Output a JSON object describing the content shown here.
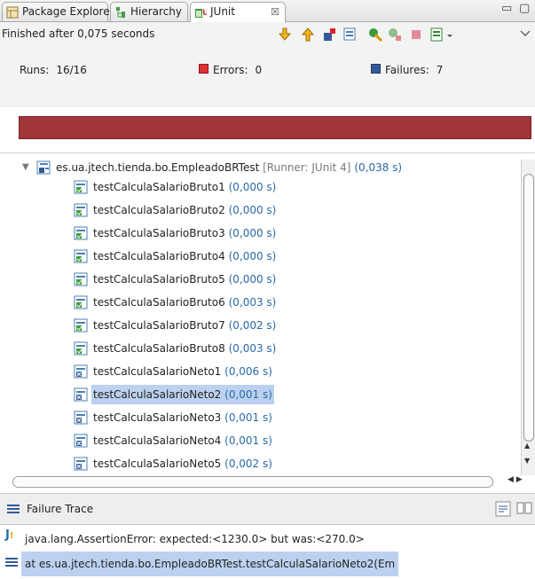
{
  "tabs": [
    {
      "label": "Package Explorer",
      "icon": "package-explorer-icon"
    },
    {
      "label": "Hierarchy",
      "icon": "hierarchy-icon"
    },
    {
      "label": "JUnit",
      "icon": "junit-icon",
      "close": "☒",
      "active": true
    }
  ],
  "view_controls": {
    "minimize": "▭",
    "maximize": "▢"
  },
  "status": {
    "text": "Finished after 0,075 seconds"
  },
  "counters": {
    "runs_label": "Runs:",
    "runs_value": "16/16",
    "errors_label": "Errors:",
    "errors_value": "0",
    "failures_label": "Failures:",
    "failures_value": "7"
  },
  "colors": {
    "progress": "#a0363a",
    "selection": "#bcd1ef",
    "time": "#2a6aa8"
  },
  "tree": {
    "root": {
      "label": "es.ua.jtech.tienda.bo.EmpleadoBRTest",
      "runner": "[Runner: JUnit 4]",
      "time": "(0,038 s)"
    },
    "items": [
      {
        "label": "testCalculaSalarioBruto1",
        "time": "(0,000 s)",
        "status": "pass"
      },
      {
        "label": "testCalculaSalarioBruto2",
        "time": "(0,000 s)",
        "status": "pass"
      },
      {
        "label": "testCalculaSalarioBruto3",
        "time": "(0,000 s)",
        "status": "pass"
      },
      {
        "label": "testCalculaSalarioBruto4",
        "time": "(0,000 s)",
        "status": "pass"
      },
      {
        "label": "testCalculaSalarioBruto5",
        "time": "(0,000 s)",
        "status": "pass"
      },
      {
        "label": "testCalculaSalarioBruto6",
        "time": "(0,003 s)",
        "status": "pass"
      },
      {
        "label": "testCalculaSalarioBruto7",
        "time": "(0,002 s)",
        "status": "pass"
      },
      {
        "label": "testCalculaSalarioBruto8",
        "time": "(0,003 s)",
        "status": "pass"
      },
      {
        "label": "testCalculaSalarioNeto1",
        "time": "(0,006 s)",
        "status": "fail"
      },
      {
        "label": "testCalculaSalarioNeto2",
        "time": "(0,001 s)",
        "status": "fail",
        "selected": true
      },
      {
        "label": "testCalculaSalarioNeto3",
        "time": "(0,001 s)",
        "status": "fail"
      },
      {
        "label": "testCalculaSalarioNeto4",
        "time": "(0,001 s)",
        "status": "fail"
      },
      {
        "label": "testCalculaSalarioNeto5",
        "time": "(0,002 s)",
        "status": "fail"
      }
    ]
  },
  "failure_trace": {
    "title": "Failure Trace",
    "lines": [
      {
        "text": "java.lang.AssertionError: expected:<1230.0> but was:<270.0>",
        "icon": "assertion-error-icon"
      },
      {
        "text": "at es.ua.jtech.tienda.bo.EmpleadoBRTest.testCalculaSalarioNeto2(Em",
        "icon": "stack-frame-icon",
        "selected": true
      }
    ]
  }
}
